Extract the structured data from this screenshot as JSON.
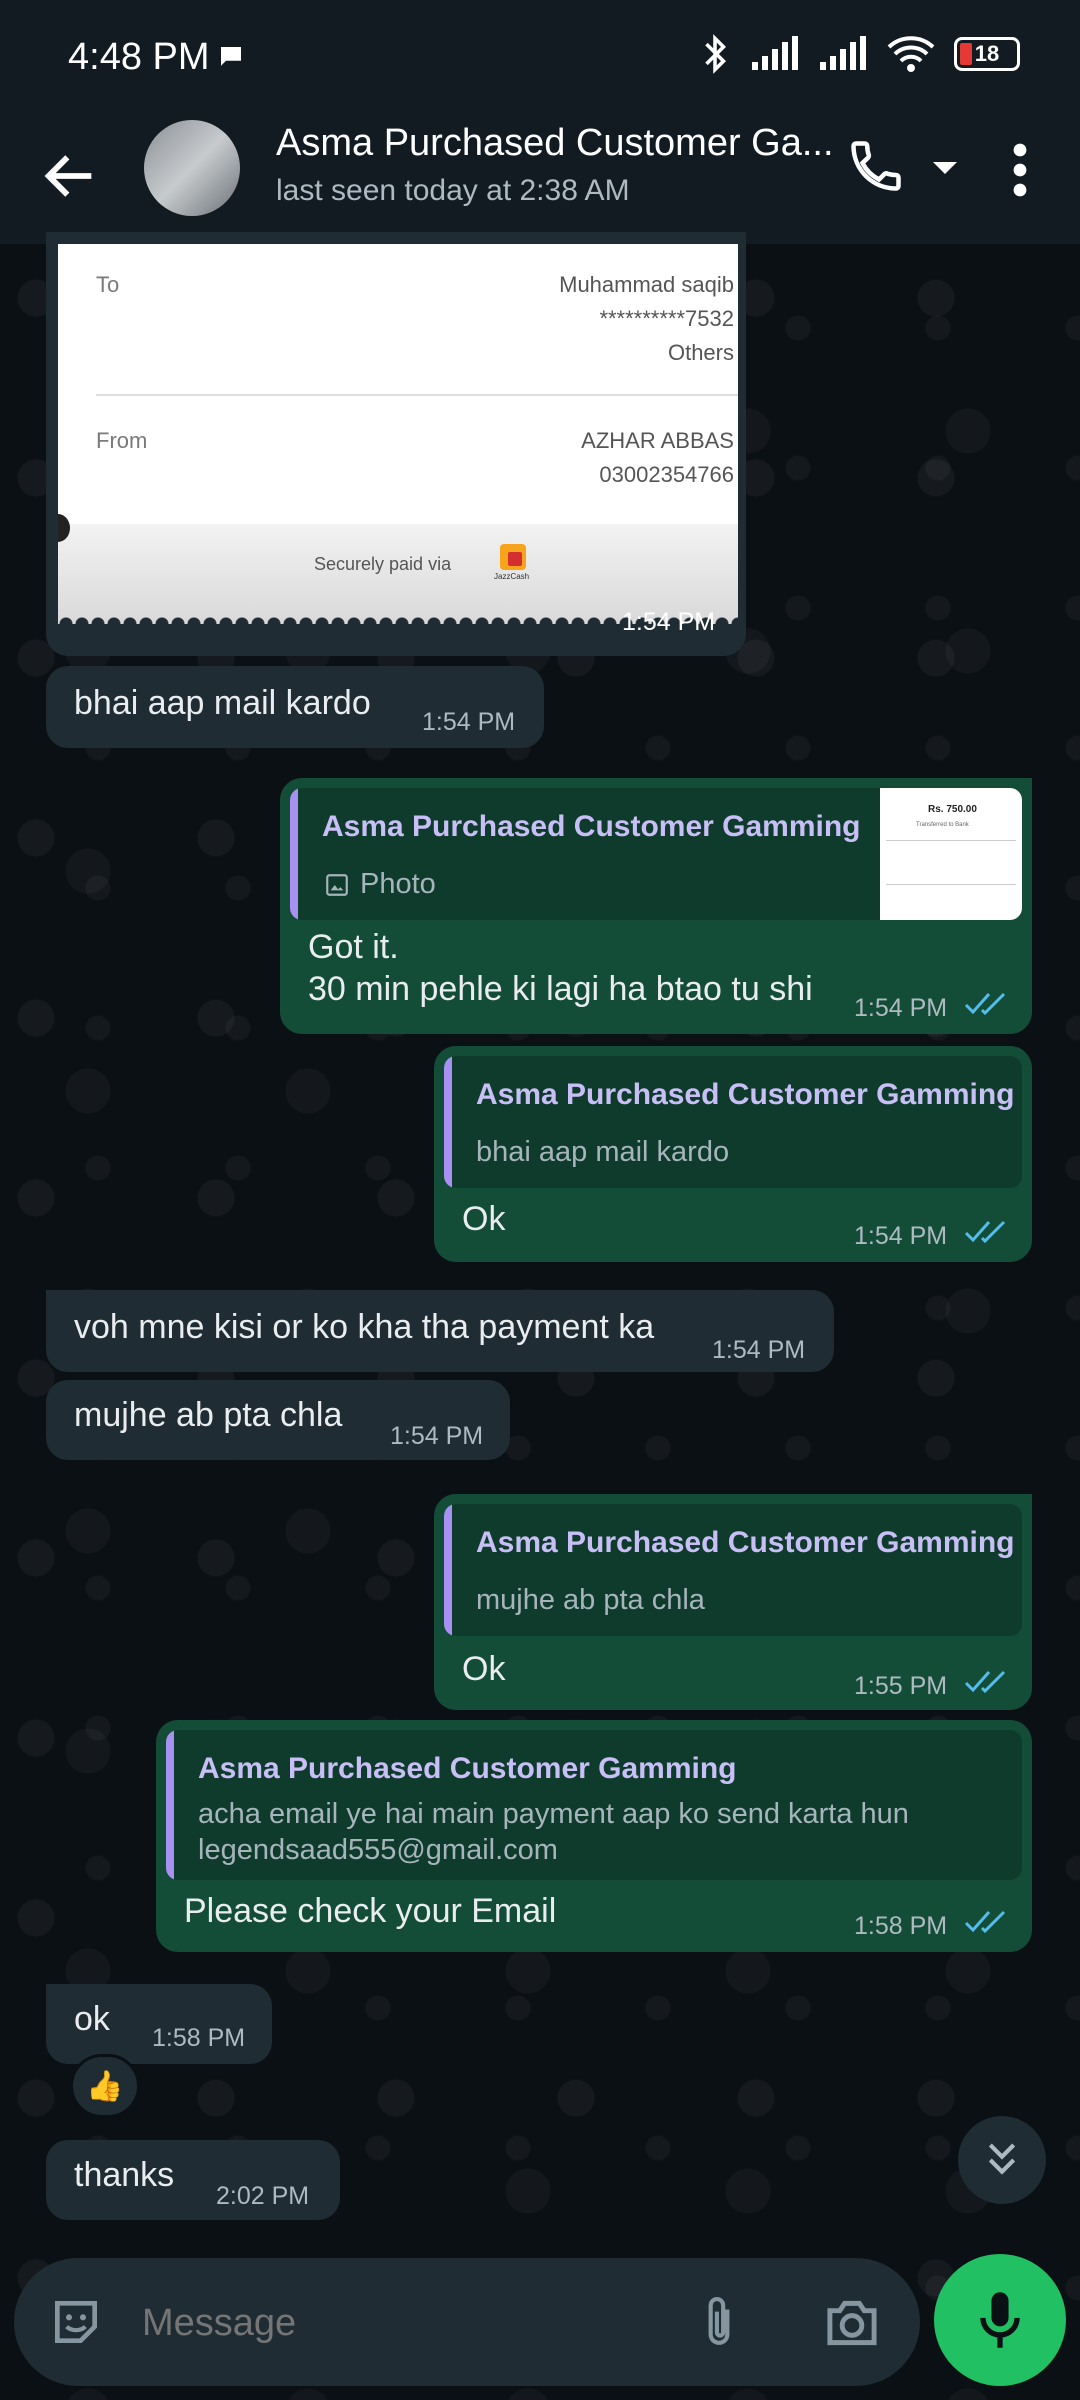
{
  "status_bar": {
    "time": "4:48 PM",
    "battery": "18"
  },
  "header": {
    "title": "Asma Purchased Customer Ga...",
    "subtitle": "last seen today at 2:38 AM"
  },
  "receipt": {
    "to_label": "To",
    "to_name": "Muhammad saqib",
    "to_account": "**********7532",
    "to_type": "Others",
    "from_label": "From",
    "from_name": "AZHAR ABBAS",
    "from_number": "03002354766",
    "secured": "Securely paid via",
    "brand": "JazzCash",
    "time": "1:54 PM"
  },
  "messages": {
    "m1": {
      "text": "bhai aap mail kardo",
      "time": "1:54 PM"
    },
    "m2": {
      "quote_name": "Asma Purchased Customer Gamming",
      "quote_text": "Photo",
      "line1": "Got it.",
      "line2": "30 min pehle ki lagi ha btao tu shi",
      "time": "1:54 PM",
      "thumb_amount": "Rs. 750.00",
      "thumb_caption": "Transferred to Bank"
    },
    "m3": {
      "quote_name": "Asma Purchased Customer Gamming",
      "quote_text": "bhai aap mail kardo",
      "text": "Ok",
      "time": "1:54 PM"
    },
    "m4": {
      "text": "voh mne kisi or ko kha tha payment ka",
      "time": "1:54 PM"
    },
    "m5": {
      "text": "mujhe ab pta chla",
      "time": "1:54 PM"
    },
    "m6": {
      "quote_name": "Asma Purchased Customer Gamming",
      "quote_text": "mujhe ab pta chla",
      "text": "Ok",
      "time": "1:55 PM"
    },
    "m7": {
      "quote_name": "Asma Purchased Customer Gamming",
      "quote_line1": "acha email ye hai main payment aap ko send karta hun",
      "quote_line2": "legendsaad555@gmail.com",
      "text": "Please check your Email",
      "time": "1:58 PM"
    },
    "m8": {
      "text": "ok",
      "time": "1:58 PM",
      "reaction": "👍"
    },
    "m9": {
      "text": "thanks",
      "time": "2:02 PM"
    }
  },
  "composer": {
    "placeholder": "Message"
  },
  "colors": {
    "incoming": "#1f2c33",
    "outgoing": "#144d37",
    "accent": "#21c063",
    "read_ticks": "#53bdeb"
  }
}
